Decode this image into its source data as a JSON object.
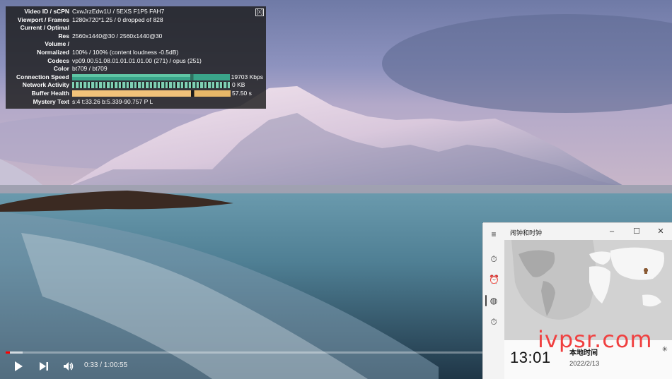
{
  "stats": {
    "rows": [
      {
        "k": "Video ID / sCPN",
        "v": "CxwJrzEdw1U / 5EXS F1P5 FAH7"
      },
      {
        "k": "Viewport / Frames",
        "v": "1280x720*1.25 / 0 dropped of 828"
      },
      {
        "k": "Current / Optimal",
        "v": ""
      },
      {
        "k": "Res",
        "v": "2560x1440@30 / 2560x1440@30"
      },
      {
        "k": "Volume /",
        "v": ""
      },
      {
        "k": "Normalized",
        "v": "100% / 100% (content loudness -0.5dB)"
      },
      {
        "k": "Codecs",
        "v": "vp09.00.51.08.01.01.01.01.00 (271) / opus (251)"
      },
      {
        "k": "Color",
        "v": "bt709 / bt709"
      }
    ],
    "connection_label": "Connection Speed",
    "connection_value": "19703 Kbps",
    "network_label": "Network Activity",
    "network_value": "0 KB",
    "buffer_label": "Buffer Health",
    "buffer_value": "57.50 s",
    "mystery_label": "Mystery Text",
    "mystery_value": "s:4 t:33.26 b:5.339-90.757 P L",
    "close_label": "[x]"
  },
  "player": {
    "time": "0:33 / 1:00:55",
    "progress_fraction": 0.009,
    "accent_color": "#ff0000"
  },
  "clock_app": {
    "title": "闹钟和时钟",
    "time": "13:01",
    "timezone": "本地时间",
    "date": "2022/2/13"
  },
  "watermark": "ivpsr.com"
}
